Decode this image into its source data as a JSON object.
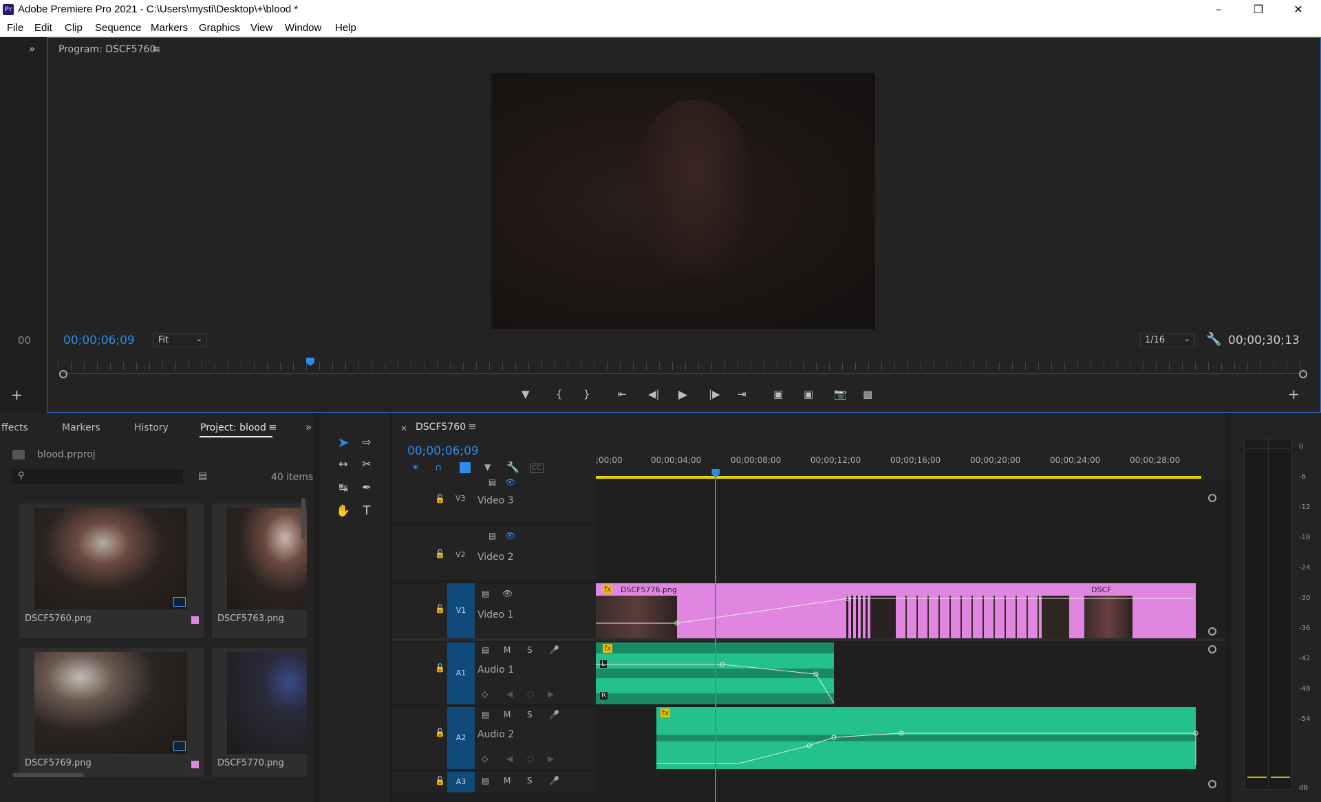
{
  "window": {
    "title": "Adobe Premiere Pro 2021 - C:\\Users\\mysti\\Desktop\\+\\blood *",
    "app_icon": "Pr",
    "controls": [
      "minimize-icon",
      "maximize-icon",
      "close-icon"
    ]
  },
  "menu": [
    "File",
    "Edit",
    "Clip",
    "Sequence",
    "Markers",
    "Graphics",
    "View",
    "Window",
    "Help"
  ],
  "left_strip": {
    "expand": "»",
    "counter": "00"
  },
  "program": {
    "title": "Program: DSCF5760",
    "timecode": "00;00;06;09",
    "fit": "Fit",
    "resolution": "1/16",
    "duration": "00;00;30;13",
    "playhead_fraction": 0.2
  },
  "project": {
    "tabs": [
      "ffects",
      "Markers",
      "History",
      "Project: blood"
    ],
    "file": "blood.prproj",
    "items_count": "40 items",
    "search_placeholder": "",
    "thumbs": [
      {
        "name": "DSCF5760.png"
      },
      {
        "name": "DSCF5763.png"
      },
      {
        "name": "DSCF5769.png"
      },
      {
        "name": "DSCF5770.png"
      }
    ]
  },
  "timeline": {
    "sequence_tab": "DSCF5760",
    "timecode": "00;00;06;09",
    "ruler_labels": [
      ";00;00",
      "00;00;04;00",
      "00;00;08;00",
      "00;00;12;00",
      "00;00;16;00",
      "00;00;20;00",
      "00;00;24;00",
      "00;00;28;00"
    ],
    "tracks": {
      "v3": {
        "badge": "V3",
        "name": "Video 3"
      },
      "v2": {
        "badge": "V2",
        "name": "Video 2"
      },
      "v1": {
        "badge": "V1",
        "name": "Video 1"
      },
      "a1": {
        "badge": "A1",
        "name": "Audio 1"
      },
      "a2": {
        "badge": "A2",
        "name": "Audio 2"
      },
      "a3": {
        "badge": "A3",
        "name": ""
      }
    },
    "clip_labels": {
      "v1_first": "DSCF5776.png",
      "v1_last": "DSCF"
    },
    "m": "M",
    "s": "S",
    "fx": "fx",
    "l": "L",
    "r": "R"
  },
  "meters": {
    "scale": [
      "0",
      "-6",
      "-12",
      "-18",
      "-24",
      "-30",
      "-36",
      "-42",
      "-48",
      "-54",
      "dB"
    ]
  },
  "colors": {
    "accent": "#2d8ceb",
    "video_clip": "#e186e0",
    "audio_clip": "#1a8a62",
    "track_badge": "#0f4a7a",
    "work_area": "#e6d200"
  }
}
